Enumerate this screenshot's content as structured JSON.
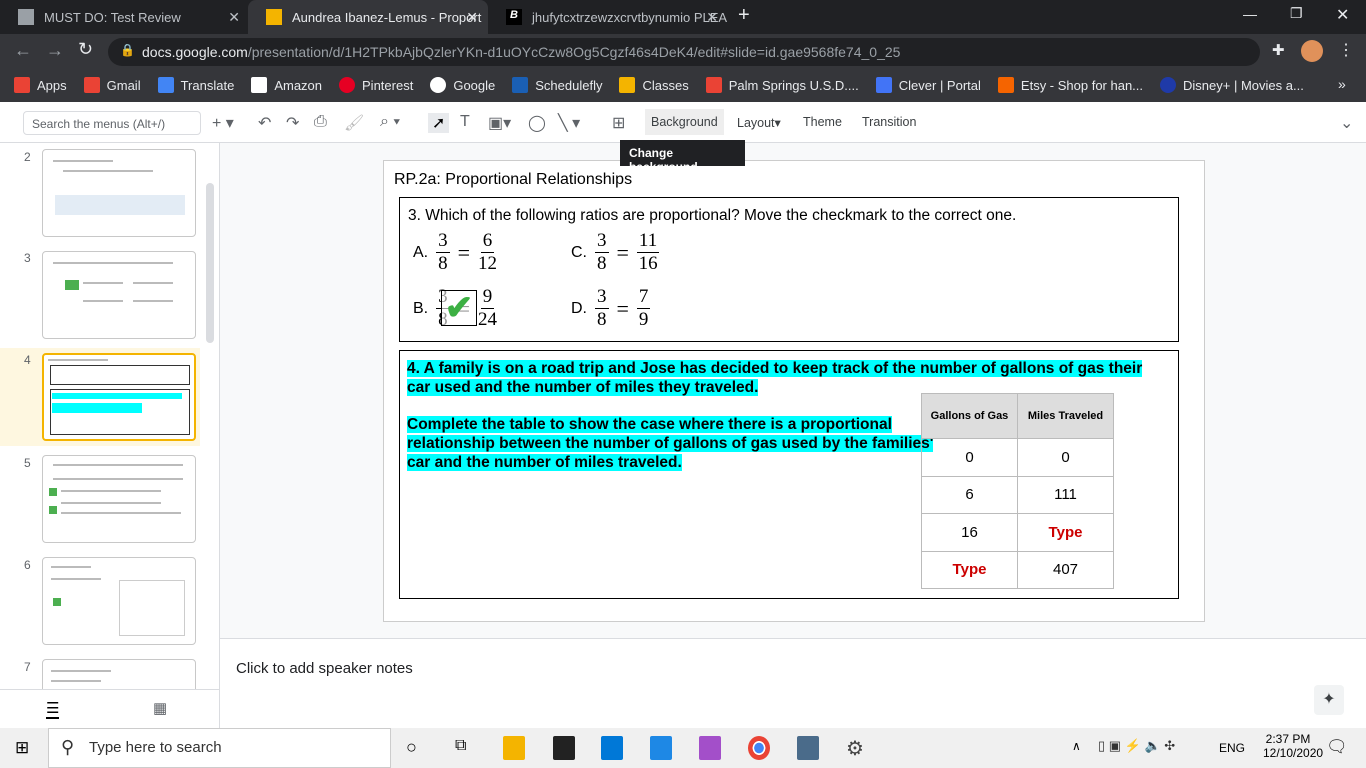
{
  "browser": {
    "tabs": [
      {
        "title": "MUST DO: Test Review"
      },
      {
        "title": "Aundrea Ibanez-Lemus - Proport"
      },
      {
        "title": "jhufytcxtrzewzxcrvtbynumio PLEA"
      }
    ],
    "url_domain": "docs.google.com",
    "url_path": "/presentation/d/1H2TPkbAjbQzlerYKn-d1uOYcCzw8Og5Cgzf46s4DeK4/edit#slide=id.gae9568fe74_0_25",
    "bookmarks": [
      {
        "label": "Apps",
        "color": "#ea4335"
      },
      {
        "label": "Gmail",
        "color": "#ea4335"
      },
      {
        "label": "Translate",
        "color": "#4285f4"
      },
      {
        "label": "Amazon",
        "color": "#222"
      },
      {
        "label": "Pinterest",
        "color": "#e60023"
      },
      {
        "label": "Google",
        "color": "#4285f4"
      },
      {
        "label": "Schedulefly",
        "color": "#1a5fb4"
      },
      {
        "label": "Classes",
        "color": "#f4b400"
      },
      {
        "label": "Palm Springs U.S.D....",
        "color": "#ea4335"
      },
      {
        "label": "Clever | Portal",
        "color": "#4274f6"
      },
      {
        "label": "Etsy - Shop for han...",
        "color": "#f56400"
      },
      {
        "label": "Disney+ | Movies a...",
        "color": "#1f3aa8"
      }
    ]
  },
  "toolbar": {
    "search_placeholder": "Search the menus (Alt+/)",
    "background": "Background",
    "layout": "Layout",
    "theme": "Theme",
    "transition": "Transition",
    "tooltip": "Change background"
  },
  "filmstrip": {
    "slides": [
      "2",
      "3",
      "4",
      "5",
      "6",
      "7"
    ]
  },
  "slide": {
    "title": "RP.2a: Proportional Relationships",
    "q3": {
      "prompt": "3. Which of the following ratios are proportional? Move the checkmark to the correct one.",
      "options": [
        {
          "letter": "A.",
          "l": [
            "3",
            "8"
          ],
          "r": [
            "6",
            "12"
          ]
        },
        {
          "letter": "C.",
          "l": [
            "3",
            "8"
          ],
          "r": [
            "11",
            "16"
          ]
        },
        {
          "letter": "B.",
          "l": [
            "3",
            "8"
          ],
          "r": [
            "9",
            "24"
          ]
        },
        {
          "letter": "D.",
          "l": [
            "3",
            "8"
          ],
          "r": [
            "7",
            "9"
          ]
        }
      ],
      "eq": "="
    },
    "q4": {
      "p1": "4. A family is on a road trip and Jose has decided to keep track of the number of gallons of gas their car used and the number of miles they traveled.",
      "p2": "Complete the table to show the case where there is a proportional relationship between the number of gallons of gas used by the families' car and the number of miles traveled.",
      "headers": [
        "Gallons of Gas",
        "Miles Traveled"
      ],
      "rows": [
        [
          "0",
          "0"
        ],
        [
          "6",
          "111"
        ],
        [
          "16",
          "Type"
        ],
        [
          "Type",
          "407"
        ]
      ]
    }
  },
  "notes": "Click to add speaker notes",
  "taskbar": {
    "search": "Type here to search",
    "lang": "ENG",
    "time": "2:37 PM",
    "date": "12/10/2020"
  }
}
